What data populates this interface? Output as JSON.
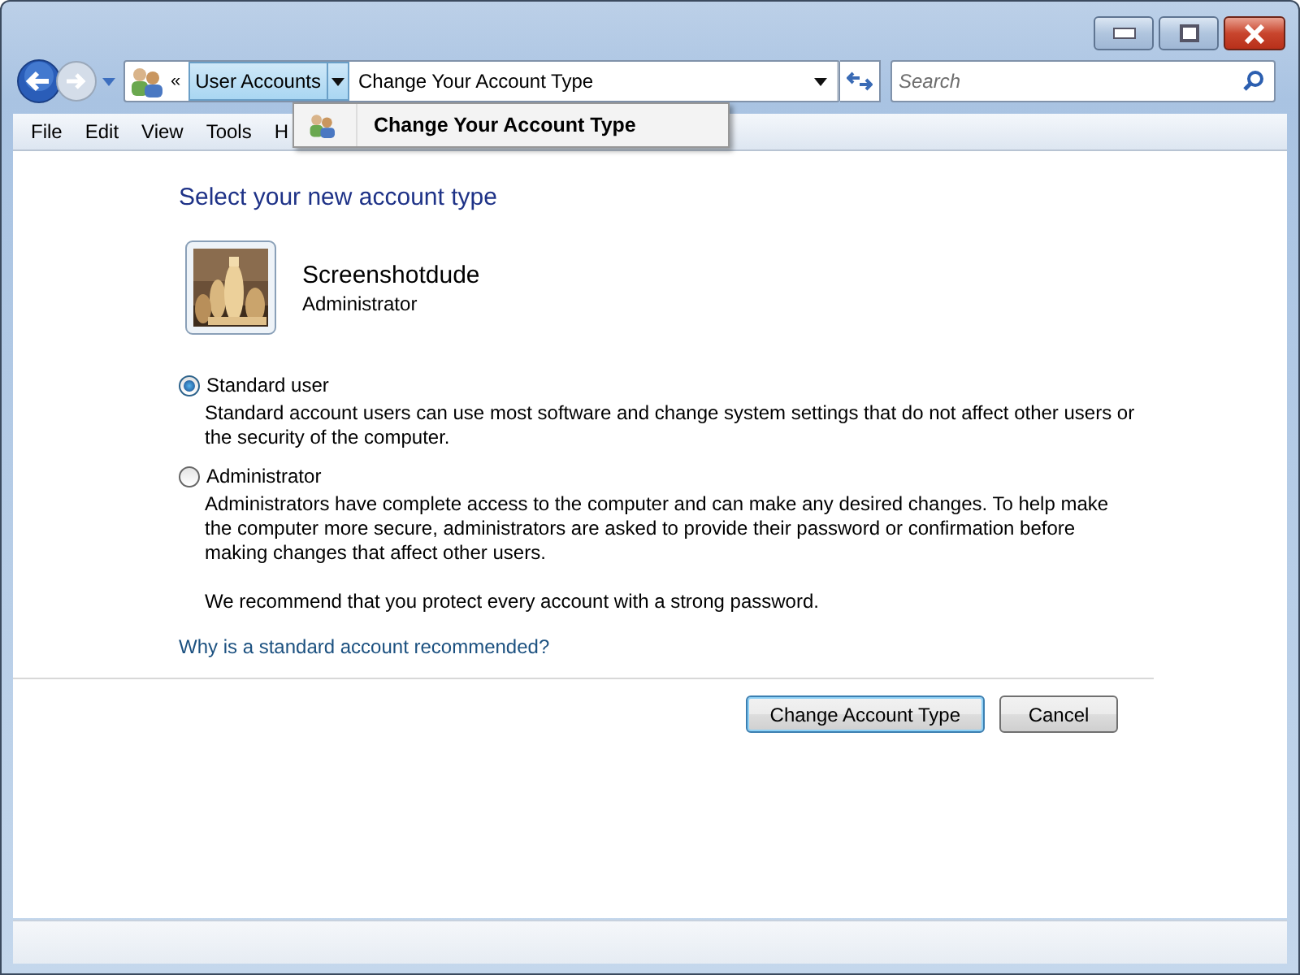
{
  "window": {
    "buttons": [
      {
        "kind": "minimize"
      },
      {
        "kind": "maximize"
      },
      {
        "kind": "close"
      }
    ]
  },
  "address_bar": {
    "overflow": "«",
    "breadcrumb": "User Accounts",
    "current": "Change Your Account Type"
  },
  "search": {
    "placeholder": "Search"
  },
  "breadcrumb_menu": {
    "items": [
      "Change Your Account Type"
    ]
  },
  "menu_bar": [
    "File",
    "Edit",
    "View",
    "Tools",
    "H"
  ],
  "heading": "Select your new account type",
  "account": {
    "name": "Screenshotdude",
    "role": "Administrator"
  },
  "options": [
    {
      "label": "Standard user",
      "selected": true,
      "description": [
        "Standard account users can use most software and change system settings that do not affect other users or the security of the computer."
      ]
    },
    {
      "label": "Administrator",
      "selected": false,
      "description": [
        "Administrators have complete access to the computer and can make any desired changes. To help make the computer more secure, administrators are asked to provide their password or confirmation before making changes that affect other users.",
        "We recommend that you protect every account with a strong password."
      ]
    }
  ],
  "help_link": "Why is a standard account recommended?",
  "buttons": [
    {
      "label": "Change Account Type",
      "default": true
    },
    {
      "label": "Cancel",
      "default": false
    }
  ]
}
